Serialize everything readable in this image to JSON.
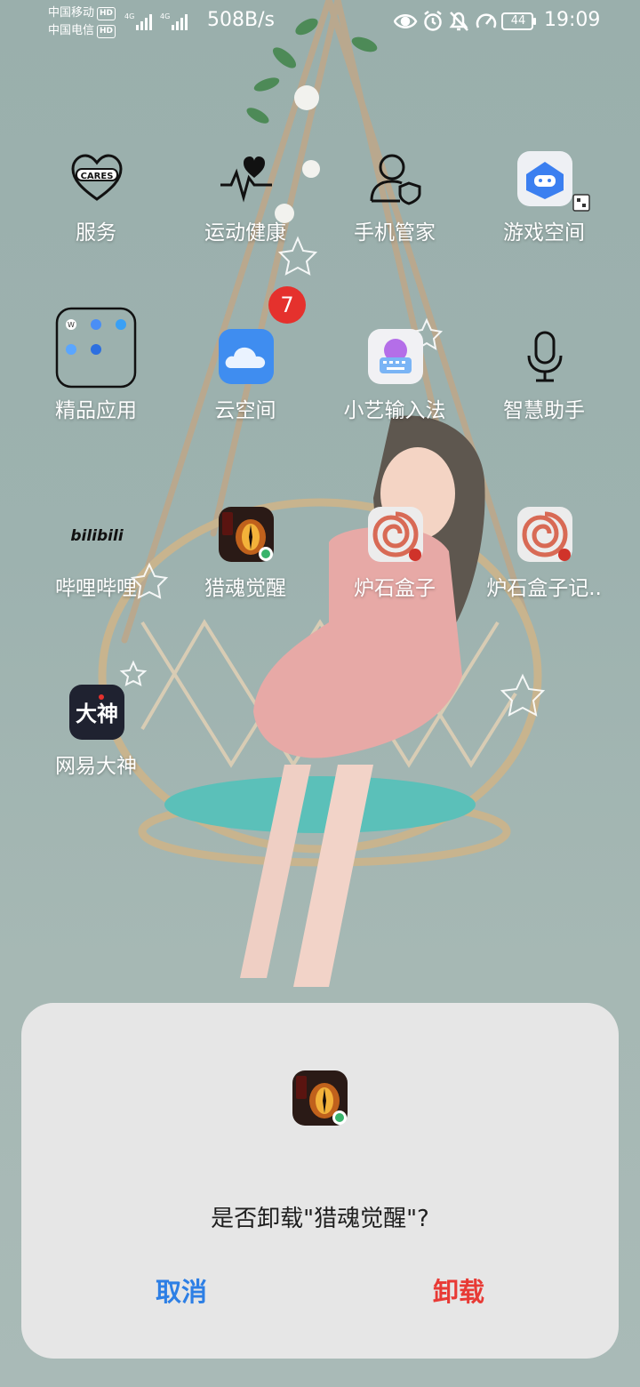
{
  "status_bar": {
    "carrier1": "中国移动",
    "carrier2": "中国电信",
    "hd_label": "HD",
    "network_type": "4G",
    "net_speed": "508B/s",
    "battery": "44",
    "time": "19:09",
    "icons": [
      "eye-icon",
      "alarm-icon",
      "mute-icon",
      "speedometer-icon",
      "battery-icon"
    ]
  },
  "apps": [
    {
      "label": "服务",
      "icon": "cares-heart-icon"
    },
    {
      "label": "运动健康",
      "icon": "health-icon"
    },
    {
      "label": "手机管家",
      "icon": "phone-manager-icon"
    },
    {
      "label": "游戏空间",
      "icon": "game-space-icon"
    },
    {
      "label": "精品应用",
      "icon": "folder-icon"
    },
    {
      "label": "云空间",
      "icon": "cloud-icon",
      "badge": "7"
    },
    {
      "label": "小艺输入法",
      "icon": "keyboard-icon"
    },
    {
      "label": "智慧助手",
      "icon": "microphone-icon"
    },
    {
      "label": "哔哩哔哩",
      "icon": "bilibili-icon",
      "logo_text": "bilibili"
    },
    {
      "label": "猎魂觉醒",
      "icon": "dragon-eye-icon"
    },
    {
      "label": "炉石盒子",
      "icon": "hearthstone-box-icon"
    },
    {
      "label": "炉石盒子记..",
      "icon": "hearthstone-box-icon"
    },
    {
      "label": "网易大神",
      "icon": "dashen-icon",
      "logo_text": "大神"
    }
  ],
  "dialog": {
    "app_icon": "dragon-eye-icon",
    "message": "是否卸载\"猎魂觉醒\"?",
    "cancel_label": "取消",
    "confirm_label": "卸载"
  },
  "colors": {
    "cancel": "#2d7fe5",
    "confirm": "#e83a35",
    "badge": "#e5312d",
    "dialog_bg": "#e6e6e6"
  }
}
